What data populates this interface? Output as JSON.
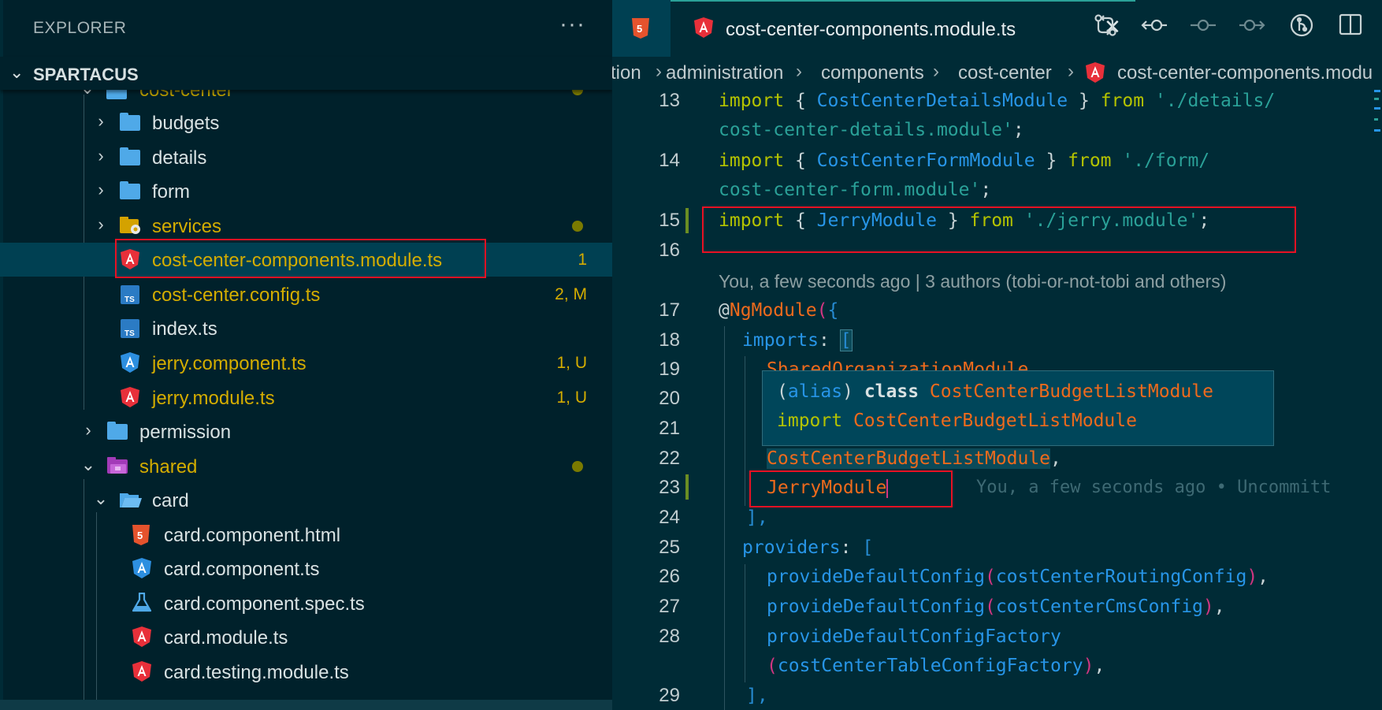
{
  "explorer": {
    "title": "EXPLORER",
    "more": "···",
    "section_title": "SPARTACUS",
    "items": [
      {
        "label": "cost-center",
        "kind": "folder-open"
      },
      {
        "label": "budgets",
        "kind": "folder"
      },
      {
        "label": "details",
        "kind": "folder"
      },
      {
        "label": "form",
        "kind": "folder"
      },
      {
        "label": "services",
        "kind": "folder-special"
      },
      {
        "label": "cost-center-components.module.ts",
        "kind": "angular",
        "badge": "1"
      },
      {
        "label": "cost-center.config.ts",
        "kind": "ts",
        "badge": "2, M"
      },
      {
        "label": "index.ts",
        "kind": "ts"
      },
      {
        "label": "jerry.component.ts",
        "kind": "angular-component",
        "badge": "1, U"
      },
      {
        "label": "jerry.module.ts",
        "kind": "angular",
        "badge": "1, U"
      },
      {
        "label": "permission",
        "kind": "folder"
      },
      {
        "label": "shared",
        "kind": "folder-open"
      },
      {
        "label": "card",
        "kind": "folder-open"
      },
      {
        "label": "card.component.html",
        "kind": "html"
      },
      {
        "label": "card.component.ts",
        "kind": "angular-component"
      },
      {
        "label": "card.component.spec.ts",
        "kind": "test"
      },
      {
        "label": "card.module.ts",
        "kind": "angular"
      },
      {
        "label": "card.testing.module.ts",
        "kind": "angular"
      }
    ]
  },
  "editor": {
    "active_tab": "cost-center-components.module.ts",
    "close_glyph": "✕",
    "breadcrumbs": [
      "tion",
      "administration",
      "components",
      "cost-center",
      "cost-center-components.modu"
    ],
    "blame": "You, a few seconds ago | 3 authors (tobi-or-not-tobi and others)",
    "inline_blame": "You, a few seconds ago • Uncommitt",
    "line_numbers": [
      "13",
      "14",
      "15",
      "16",
      "17",
      "18",
      "19",
      "20",
      "21",
      "22",
      "23",
      "24",
      "25",
      "26",
      "27",
      "28",
      "29"
    ],
    "code": {
      "l13a_kw": "import",
      "l13a_p1": " { ",
      "l13a_id": "CostCenterDetailsModule",
      "l13a_p2": " } ",
      "l13a_from": "from",
      "l13a_str": " './details/",
      "l13b_str": "cost-center-details.module'",
      "semi": ";",
      "l14a_kw": "import",
      "l14a_id": "CostCenterFormModule",
      "l14a_from": "from",
      "l14a_str": " './form/",
      "l14b_str": "cost-center-form.module'",
      "l15_kw": "import",
      "l15_id": "JerryModule",
      "l15_from": "from",
      "l15_str": " './jerry.module'",
      "l17_at": "@",
      "l17_dec": "NgModule",
      "l17_paren": "(",
      "l17_brace": "{",
      "l18_key": "imports",
      "l18_colon": ": ",
      "l18_br": "[",
      "l19": "SharedOrganizationModule",
      "l22": "CostCenterBudgetListModule",
      "comma": ",",
      "l23": "JerryModule",
      "l24": "],",
      "l25_key": "providers",
      "l26_fn": "provideDefaultConfig",
      "l26_arg": "costCenterRoutingConfig",
      "l27_fn": "provideDefaultConfig",
      "l27_arg": "costCenterCmsConfig",
      "l28_fn": "provideDefaultConfigFactory",
      "l28b_arg": "costCenterTableConfigFactory",
      "l29": "],"
    },
    "hover": {
      "line1_p1": "(",
      "line1_alias": "alias",
      "line1_p2": ") ",
      "line1_kw": "class",
      "line1_name": " CostCenterBudgetListModule",
      "line2_kw": "import",
      "line2_name": " CostCenterBudgetListModule"
    }
  },
  "colors": {
    "background": "#002b36",
    "sidebar": "#00212b",
    "highlight_box": "#e81123",
    "keyword": "#b4c300",
    "identifier": "#2795e7",
    "string": "#2aa198",
    "class": "#ef6a1c"
  }
}
